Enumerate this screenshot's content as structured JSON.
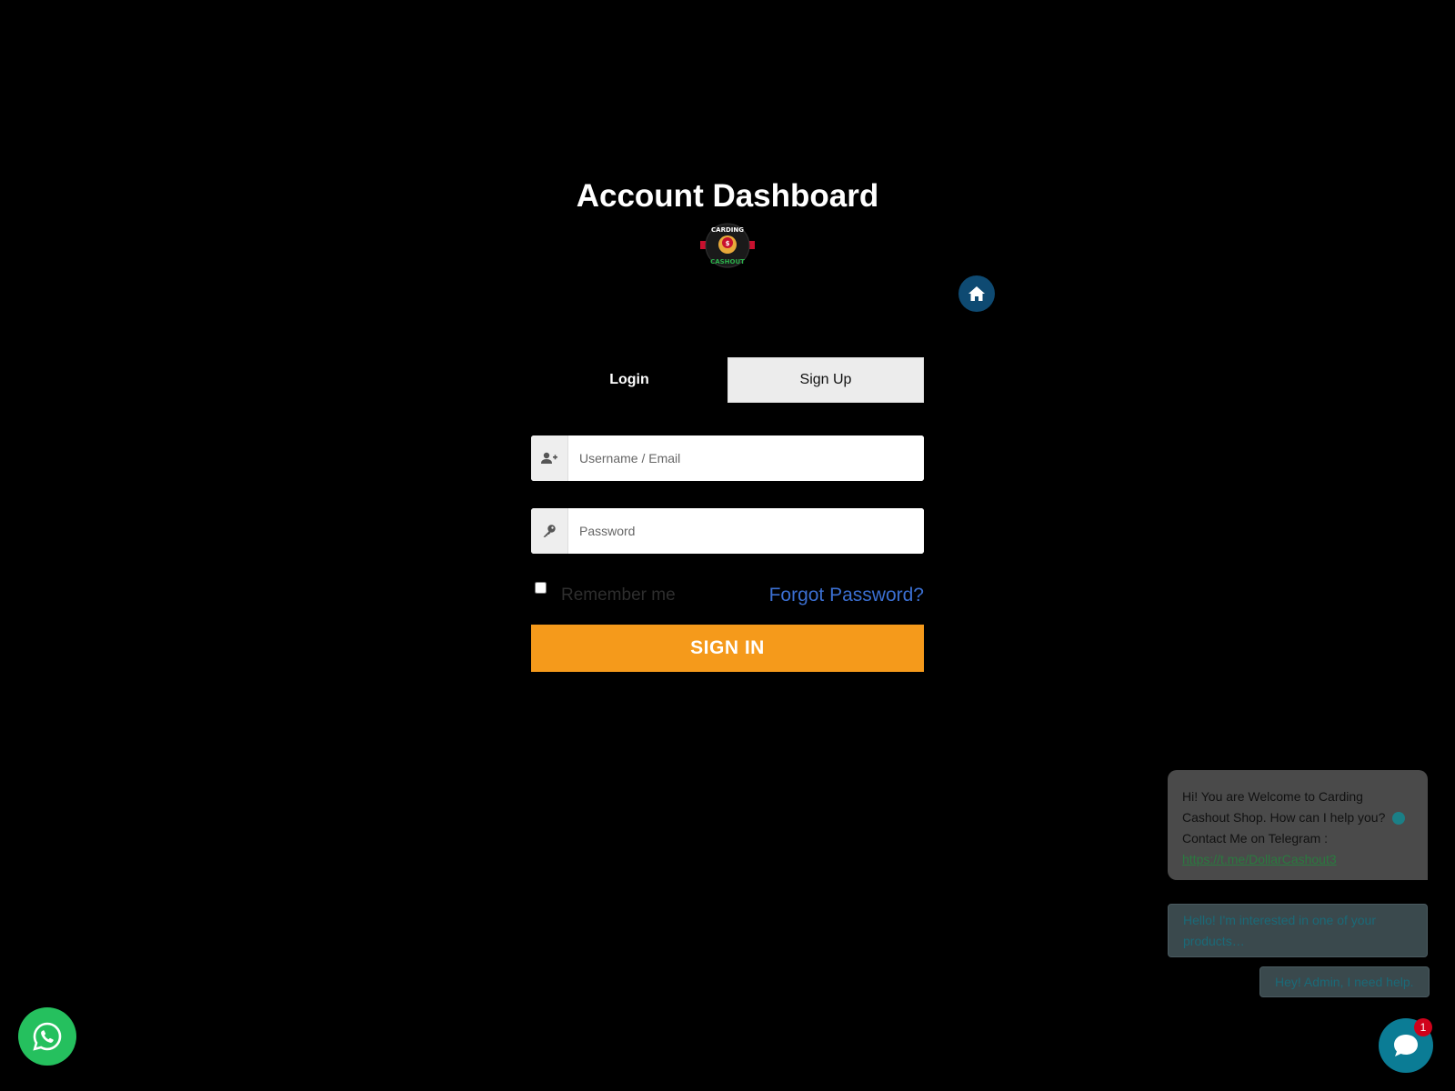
{
  "page": {
    "title": "Account Dashboard"
  },
  "logo": {
    "name": "carding-cashout-logo",
    "text_top": "CARDING",
    "text_bottom": "CASHOUT"
  },
  "home_button": {
    "icon": "home-icon"
  },
  "tabs": [
    {
      "label": "Login",
      "active": true
    },
    {
      "label": "Sign Up",
      "active": false
    }
  ],
  "form": {
    "username": {
      "placeholder": "Username / Email",
      "value": "",
      "icon": "user-plus-icon"
    },
    "password": {
      "placeholder": "Password",
      "value": "",
      "icon": "key-icon"
    },
    "remember_label": "Remember me",
    "remember_checked": false,
    "forgot_label": "Forgot Password?",
    "submit_label": "SIGN IN"
  },
  "chat": {
    "greeting_line1": "Hi! You are Welcome to Carding Cashout Shop. How can I help you?",
    "greeting_line2": "Contact Me on Telegram :",
    "telegram_link": "https://t.me/DollarCashout3",
    "quick_replies": [
      "Hello! I'm interested in one of your products…",
      "Hey! Admin, I need help."
    ],
    "unread_count": "1"
  },
  "colors": {
    "background": "#000000",
    "accent_orange": "#f59a1b",
    "link_blue": "#3b6fd1",
    "home_blue": "#0e4a72",
    "whatsapp_green": "#25c05e",
    "chat_teal": "#0b7c95",
    "badge_red": "#d0021b"
  }
}
